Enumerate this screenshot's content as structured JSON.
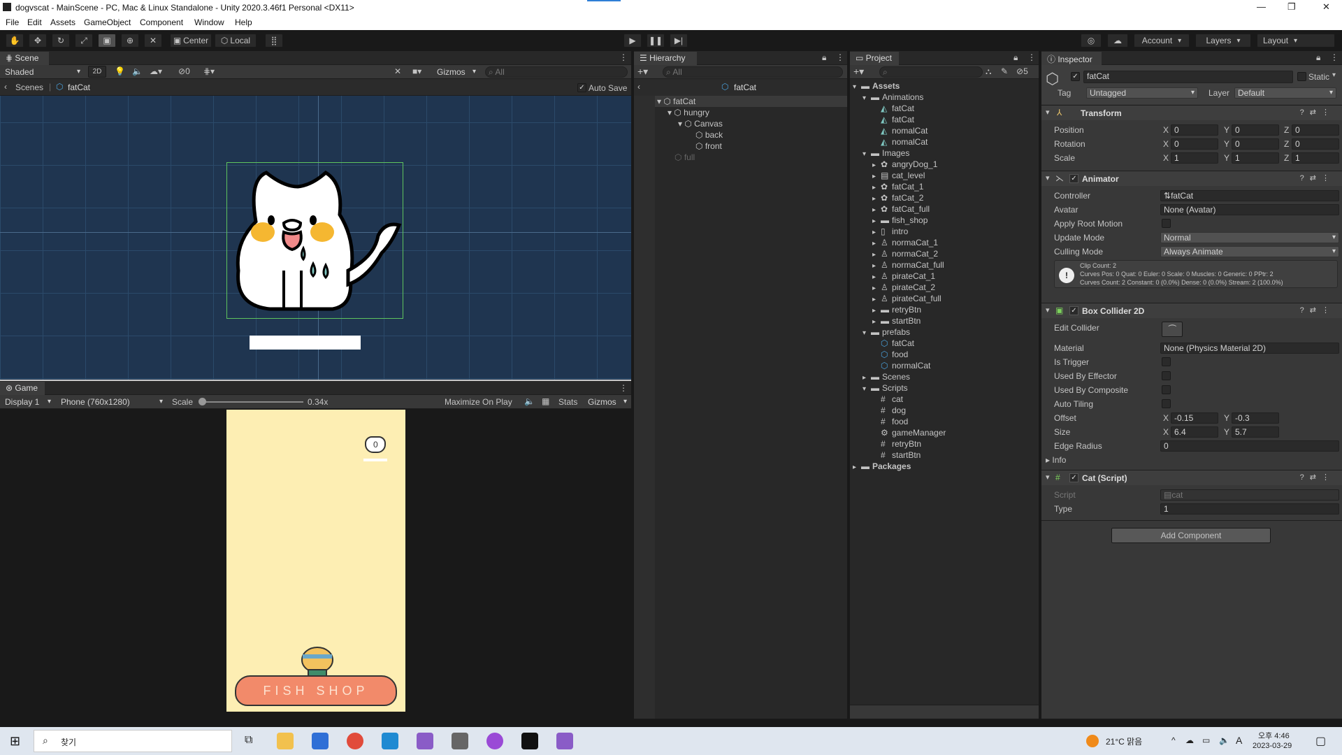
{
  "window": {
    "title": "dogvscat - MainScene - PC, Mac & Linux Standalone - Unity 2020.3.46f1 Personal <DX11>"
  },
  "menu": [
    "File",
    "Edit",
    "Assets",
    "GameObject",
    "Component",
    "Window",
    "Help"
  ],
  "toolbar": {
    "center": "Center",
    "local": "Local",
    "account": "Account",
    "layers": "Layers",
    "layout": "Layout"
  },
  "scene": {
    "tab": "Scene",
    "shading": "Shaded",
    "mode2d": "2D",
    "hidden_count": "0",
    "gizmos": "Gizmos",
    "search_placeholder": "All",
    "breadcrumb_root": "Scenes",
    "breadcrumb_obj": "fatCat",
    "auto_save": "Auto Save"
  },
  "game": {
    "tab": "Game",
    "display": "Display 1",
    "resolution": "Phone (760x1280)",
    "scale_label": "Scale",
    "scale_value": "0.34x",
    "maximize": "Maximize On Play",
    "stats": "Stats",
    "gizmos": "Gizmos",
    "score": "0",
    "shop_text": "FISH  SHOP"
  },
  "hierarchy": {
    "tab": "Hierarchy",
    "search_placeholder": "All",
    "title": "fatCat",
    "items": [
      "fatCat",
      "hungry",
      "Canvas",
      "back",
      "front",
      "full"
    ]
  },
  "project": {
    "tab": "Project",
    "hidden_count": "5",
    "items": [
      "Assets",
      "Animations",
      "fatCat",
      "fatCat",
      "nomalCat",
      "nomalCat",
      "Images",
      "angryDog_1",
      "cat_level",
      "fatCat_1",
      "fatCat_2",
      "fatCat_full",
      "fish_shop",
      "intro",
      "normaCat_1",
      "normaCat_2",
      "normaCat_full",
      "pirateCat_1",
      "pirateCat_2",
      "pirateCat_full",
      "retryBtn",
      "startBtn",
      "prefabs",
      "fatCat",
      "food",
      "normalCat",
      "Scenes",
      "Scripts",
      "cat",
      "dog",
      "food",
      "gameManager",
      "retryBtn",
      "startBtn",
      "Packages"
    ]
  },
  "inspector": {
    "tab": "Inspector",
    "object_name": "fatCat",
    "static": "Static",
    "tag_label": "Tag",
    "tag": "Untagged",
    "layer_label": "Layer",
    "layer": "Default",
    "transform": {
      "name": "Transform",
      "position": "Position",
      "rotation": "Rotation",
      "scale": "Scale",
      "x": "X",
      "y": "Y",
      "z": "Z",
      "pos": [
        "0",
        "0",
        "0"
      ],
      "rot": [
        "0",
        "0",
        "0"
      ],
      "scl": [
        "1",
        "1",
        "1"
      ]
    },
    "animator": {
      "name": "Animator",
      "controller_label": "Controller",
      "controller": "fatCat",
      "avatar_label": "Avatar",
      "avatar": "None (Avatar)",
      "root_motion": "Apply Root Motion",
      "update_label": "Update Mode",
      "update": "Normal",
      "culling_label": "Culling Mode",
      "culling": "Always Animate",
      "info1": "Clip Count: 2",
      "info2": "Curves Pos: 0 Quat: 0 Euler: 0 Scale: 0 Muscles: 0 Generic: 0 PPtr: 2",
      "info3": "Curves Count: 2 Constant: 0 (0.0%) Dense: 0 (0.0%) Stream: 2 (100.0%)"
    },
    "collider": {
      "name": "Box Collider 2D",
      "edit": "Edit Collider",
      "material_label": "Material",
      "material": "None (Physics Material 2D)",
      "trigger": "Is Trigger",
      "effector": "Used By Effector",
      "composite": "Used By Composite",
      "tiling": "Auto Tiling",
      "offset": "Offset",
      "offset_x": "-0.15",
      "offset_y": "-0.3",
      "size": "Size",
      "size_x": "6.4",
      "size_y": "5.7",
      "edge": "Edge Radius",
      "edge_val": "0",
      "info": "Info"
    },
    "script": {
      "name": "Cat (Script)",
      "script_label": "Script",
      "script": "cat",
      "type_label": "Type",
      "type": "1"
    },
    "add_component": "Add Component"
  },
  "taskbar": {
    "search": "찾기",
    "weather": "21°C  맑음",
    "time": "오후 4:46",
    "date": "2023-03-29",
    "ime": "A"
  }
}
